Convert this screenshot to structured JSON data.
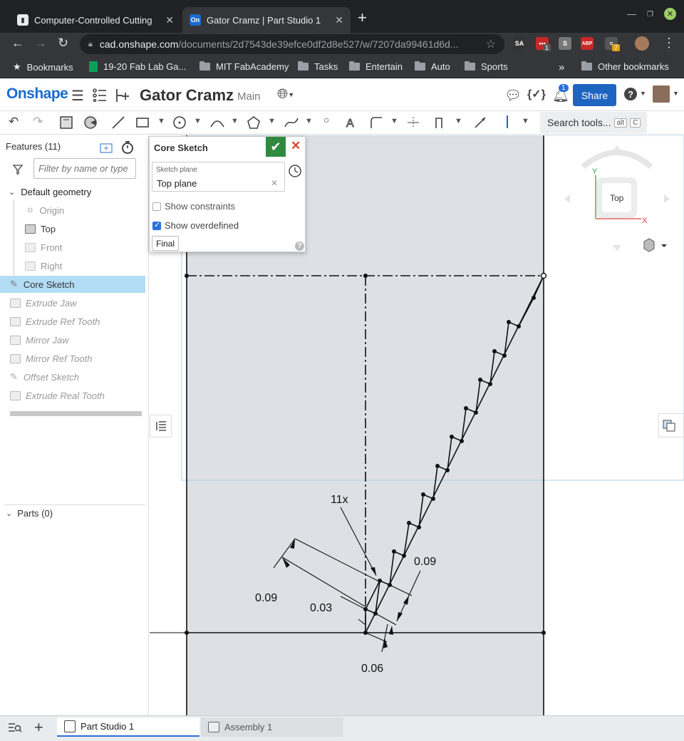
{
  "browser": {
    "tabs": [
      {
        "title": "Computer-Controlled Cutting",
        "active": false
      },
      {
        "title": "Gator Cramz | Part Studio 1",
        "active": true
      }
    ],
    "url_host": "cad.onshape.com",
    "url_path": "/documents/2d7543de39efce0df2d8e527/w/7207da99461d6d...",
    "extensions": [
      {
        "label": "SA",
        "color": "#333333"
      },
      {
        "label": "•••",
        "badge": "1",
        "color": "#c62828"
      },
      {
        "label": "S",
        "color": "#777777"
      },
      {
        "label": "ABP",
        "color": "#c62828"
      },
      {
        "label": "≡",
        "badge": "7",
        "color": "#555555"
      }
    ],
    "bookmarks": [
      {
        "label": "Bookmarks",
        "icon": "star-icon"
      },
      {
        "label": "19-20 Fab Lab Ga...",
        "icon": "sheets-icon"
      },
      {
        "label": "MIT FabAcademy",
        "icon": "folder-icon"
      },
      {
        "label": "Tasks",
        "icon": "folder-icon"
      },
      {
        "label": "Entertain",
        "icon": "folder-icon"
      },
      {
        "label": "Auto",
        "icon": "folder-icon"
      },
      {
        "label": "Sports",
        "icon": "folder-icon"
      }
    ],
    "other_bookmarks": "Other bookmarks"
  },
  "onshape": {
    "logo": "Onshape",
    "document_name": "Gator Cramz",
    "branch": "Main",
    "share_label": "Share",
    "notification_count": "1",
    "search_tools": "Search tools...",
    "search_keys": [
      "alt",
      "C"
    ]
  },
  "feature_panel": {
    "title": "Features (11)",
    "filter_placeholder": "Filter by name or type",
    "default_geometry": "Default geometry",
    "geometry_items": [
      "Origin",
      "Top",
      "Front",
      "Right"
    ],
    "features": [
      {
        "label": "Core Sketch",
        "type": "sketch",
        "selected": true
      },
      {
        "label": "Extrude Jaw",
        "type": "extrude"
      },
      {
        "label": "Extrude Ref Tooth",
        "type": "extrude"
      },
      {
        "label": "Mirror Jaw",
        "type": "mirror"
      },
      {
        "label": "Mirror Ref Tooth",
        "type": "mirror"
      },
      {
        "label": "Offset Sketch",
        "type": "sketch"
      },
      {
        "label": "Extrude Real Tooth",
        "type": "extrude"
      }
    ],
    "parts": "Parts (0)"
  },
  "sketch_dialog": {
    "title": "Core Sketch",
    "plane_label": "Sketch plane",
    "plane_value": "Top plane",
    "show_constraints": "Show constraints",
    "show_constraints_checked": false,
    "show_overdefined": "Show overdefined",
    "show_overdefined_checked": true,
    "final_label": "Final"
  },
  "view_cube": {
    "face": "Top",
    "axis_x": "X",
    "axis_y": "Y"
  },
  "sketch": {
    "pattern_label": "11x",
    "dimensions": [
      "0.09",
      "0.03",
      "0.09",
      "0.06"
    ]
  },
  "bottom_tabs": [
    {
      "label": "Part Studio 1",
      "active": true
    },
    {
      "label": "Assembly 1",
      "active": false
    }
  ],
  "colors": {
    "onshape_blue": "#1a6bd1",
    "share_blue": "#1e65c0",
    "selected_row": "#b3dcf5",
    "accept_green": "#2e8b3e",
    "cancel_red": "#d9462b",
    "sketch_plane_fill": "#dde0e4"
  }
}
